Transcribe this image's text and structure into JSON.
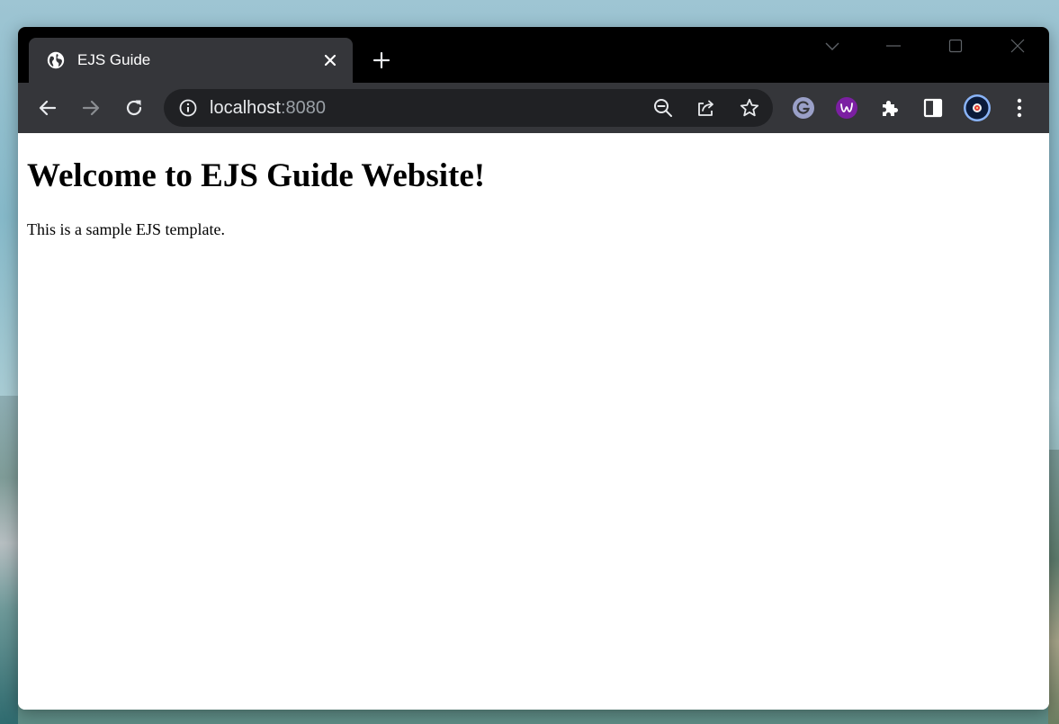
{
  "tab": {
    "title": "EJS Guide"
  },
  "address_bar": {
    "host": "localhost",
    "port": ":8080"
  },
  "page": {
    "heading": "Welcome to EJS Guide Website!",
    "paragraph": "This is a sample EJS template."
  },
  "icons": {
    "tab_favicon": "globe-icon",
    "tab_close": "close-icon",
    "new_tab": "plus-icon",
    "back": "arrow-left-icon",
    "forward": "arrow-right-icon",
    "reload": "reload-icon",
    "site_info": "info-icon",
    "zoom": "zoom-out-icon",
    "share": "share-icon",
    "bookmark": "star-icon",
    "ext_grammarly": "grammarly-icon",
    "ext_purple": "w-extension-icon",
    "extensions": "puzzle-icon",
    "side_panel": "side-panel-icon",
    "profile": "avatar",
    "menu": "kebab-menu-icon"
  },
  "colors": {
    "titlebar": "#000000",
    "toolbar": "#35363a",
    "omnibox": "#202124",
    "grammarly": "#9aa0c8",
    "purple_ext": "#7b1fa2",
    "avatar_ring": "#8ab4f8"
  }
}
